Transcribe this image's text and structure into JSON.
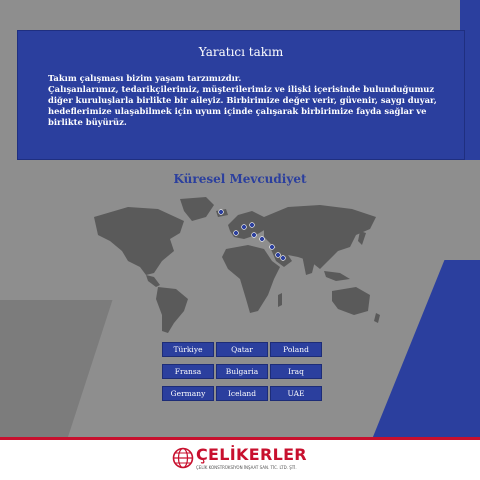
{
  "card": {
    "title": "Yaratıcı takım",
    "line1": "Takım çalışması bizim yaşam tarzımızdır.",
    "para": "Çalışanlarımız, tedarikçilerimiz, müşterilerimiz ve ilişki içerisinde bulunduğumuz diğer kuruluşlarla birlikte bir aileyiz. Birbirimize değer verir, güvenir, saygı duyar, hedeflerimize ulaşabilmek için uyum içinde çalışarak birbirimize fayda sağlar ve birlikte büyürüz."
  },
  "map_section": {
    "title": "Küresel Mevcudiyet"
  },
  "countries": [
    "Türkiye",
    "Qatar",
    "Poland",
    "Fransa",
    "Bulgaria",
    "Iraq",
    "Germany",
    "Iceland",
    "UAE"
  ],
  "logo": {
    "name": "ÇELİKERLER",
    "tagline": "ÇELİK KONSTRÜKSİYON İNŞAAT SAN. TİC. LTD. ŞTİ."
  },
  "colors": {
    "primary": "#2b3f9e",
    "accent": "#c8102e",
    "background": "#8e8e8e"
  }
}
